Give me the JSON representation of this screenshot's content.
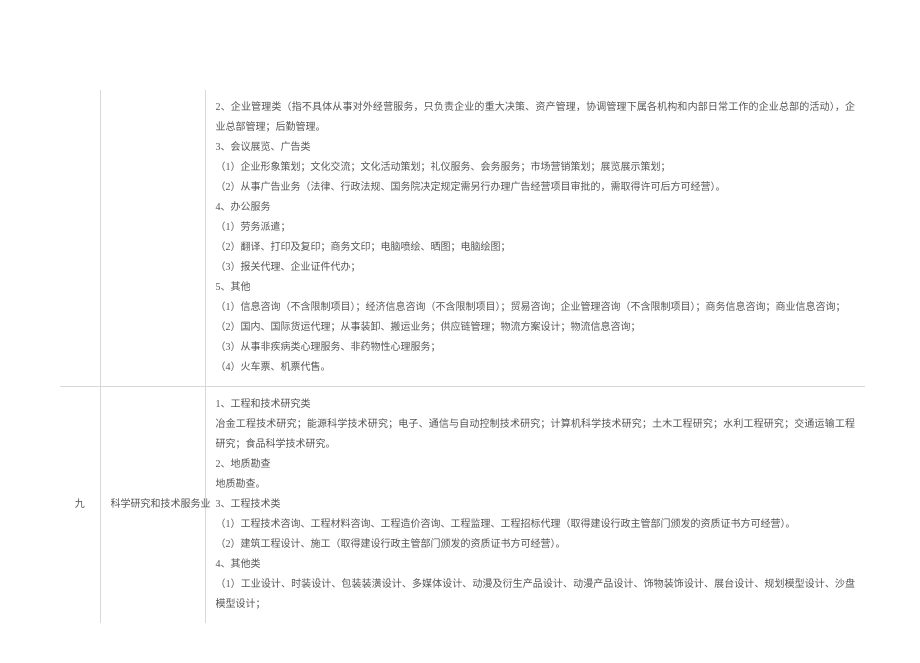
{
  "rows": [
    {
      "num": "",
      "category": "",
      "lines": [
        "2、企业管理类（指不具体从事对外经营服务，只负责企业的重大决策、资产管理，协调管理下属各机构和内部日常工作的企业总部的活动），企业总部管理；后勤管理。",
        "3、会议展览、广告类",
        "（1）企业形象策划；文化交流；文化活动策划；礼仪服务、会务服务；市场营销策划；展览展示策划；",
        "（2）从事广告业务（法律、行政法规、国务院决定规定需另行办理广告经营项目审批的，需取得许可后方可经营）。",
        "4、办公服务",
        "（1）劳务派遣；",
        "（2）翻译、打印及复印；商务文印；电脑喷绘、晒图；电脑绘图；",
        "（3）报关代理、企业证件代办；",
        "5、其他",
        "（1）信息咨询（不含限制项目）；经济信息咨询（不含限制项目）；贸易咨询；企业管理咨询（不含限制项目）；商务信息咨询；商业信息咨询；",
        "（2）国内、国际货运代理；从事装卸、搬运业务；供应链管理；物流方案设计；物流信息咨询；",
        "（3）从事非疾病类心理服务、非药物性心理服务；",
        "（4）火车票、机票代售。"
      ]
    },
    {
      "num": "九",
      "category": "科学研究和技术服务业",
      "lines": [
        "1、工程和技术研究类",
        "冶金工程技术研究；能源科学技术研究；电子、通信与自动控制技术研究；计算机科学技术研究；土木工程研究；水利工程研究；交通运输工程研究；食品科学技术研究。",
        "2、地质勘查",
        "地质勘查。",
        "3、工程技术类",
        "（1）工程技术咨询、工程材料咨询、工程造价咨询、工程监理、工程招标代理（取得建设行政主管部门颁发的资质证书方可经营）。",
        "（2）建筑工程设计、施工（取得建设行政主管部门颁发的资质证书方可经营）。",
        "4、其他类",
        "（1）工业设计、时装设计、包装装潢设计、多媒体设计、动漫及衍生产品设计、动漫产品设计、饰物装饰设计、展台设计、规划模型设计、沙盘模型设计；"
      ]
    }
  ]
}
